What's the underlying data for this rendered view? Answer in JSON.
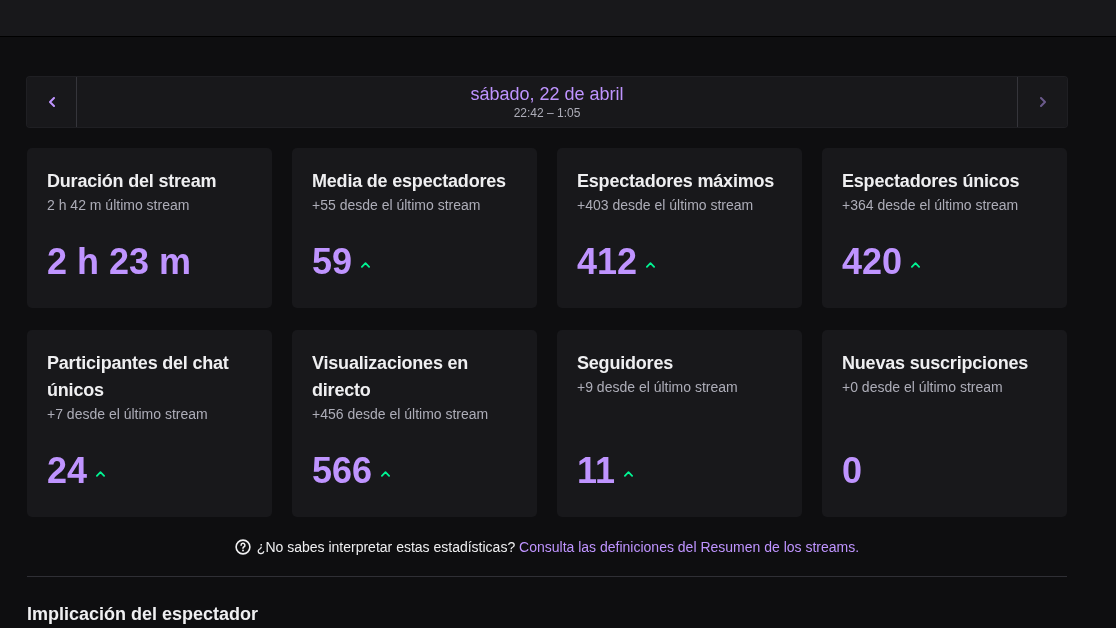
{
  "date_nav": {
    "date": "sábado, 22 de abril",
    "time_range": "22:42 – 1:05",
    "prev": {
      "disabled": false
    },
    "next": {
      "disabled": true
    }
  },
  "cards": [
    {
      "title": "Duración del stream",
      "change": "2 h 42 m último stream",
      "value": "2 h 23 m",
      "trend_up": false
    },
    {
      "title": "Media de espectadores",
      "change": "+55 desde el último stream",
      "value": "59",
      "trend_up": true
    },
    {
      "title": "Espectadores máximos",
      "change": "+403 desde el último stream",
      "value": "412",
      "trend_up": true
    },
    {
      "title": "Espectadores únicos",
      "change": "+364 desde el último stream",
      "value": "420",
      "trend_up": true
    },
    {
      "title": "Participantes del chat únicos",
      "change": "+7 desde el último stream",
      "value": "24",
      "trend_up": true
    },
    {
      "title": "Visualizaciones en directo",
      "change": "+456 desde el último stream",
      "value": "566",
      "trend_up": true
    },
    {
      "title": "Seguidores",
      "change": "+9 desde el último stream",
      "value": "11",
      "trend_up": true
    },
    {
      "title": "Nuevas suscripciones",
      "change": "+0 desde el último stream",
      "value": "0",
      "trend_up": false
    }
  ],
  "help": {
    "text": "¿No sabes interpretar estas estadísticas?",
    "link": "Consulta las definiciones del Resumen de los streams."
  },
  "section": {
    "title": "Implicación del espectador"
  }
}
